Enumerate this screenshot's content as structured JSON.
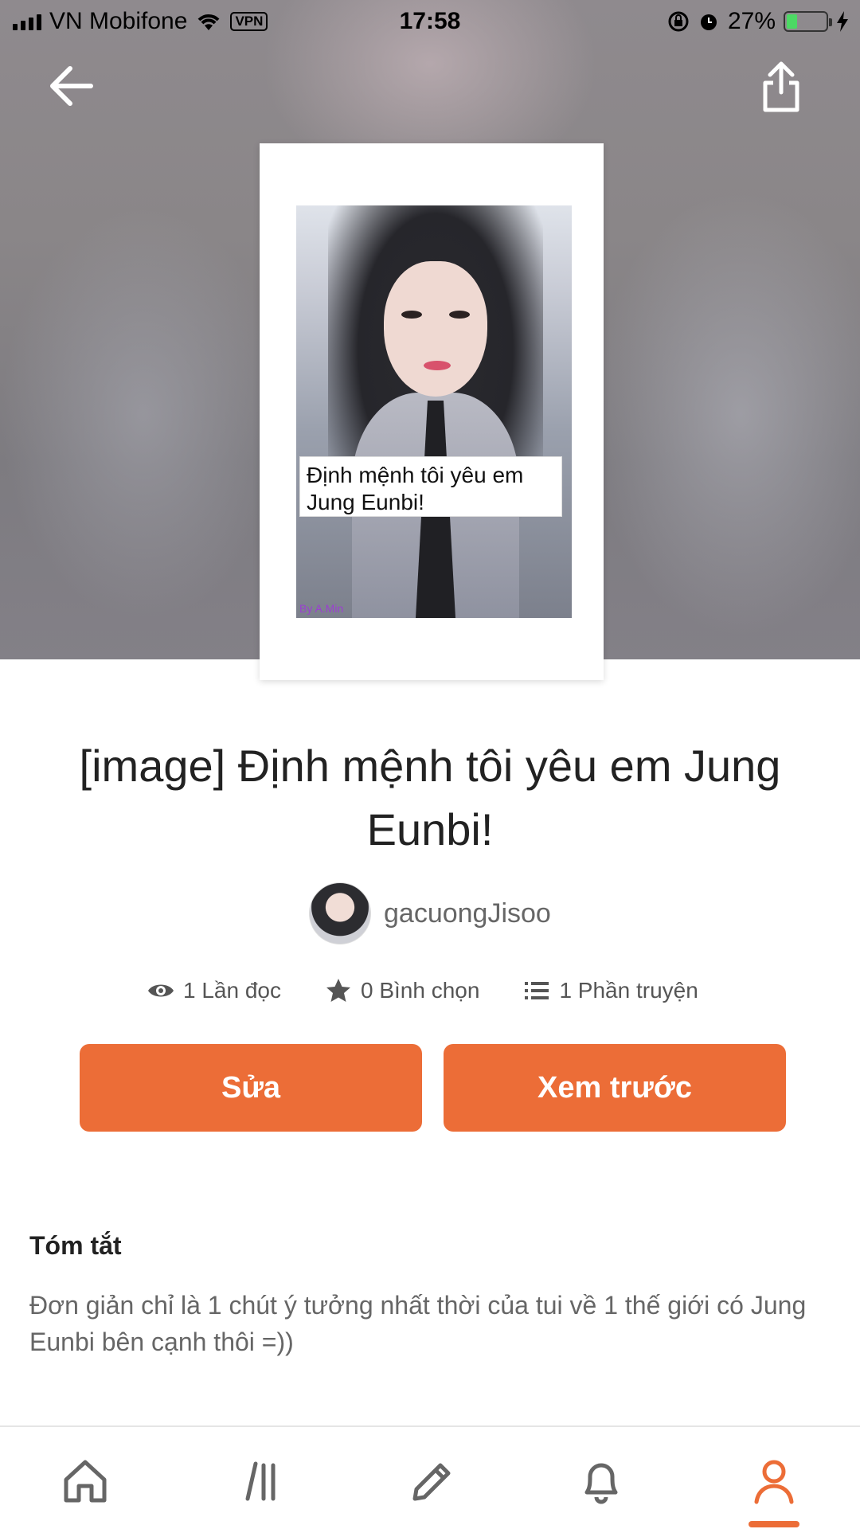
{
  "status_bar": {
    "carrier": "VN Mobifone",
    "vpn": "VPN",
    "time": "17:58",
    "battery": "27%",
    "battery_level": 0.27
  },
  "header": {
    "back_icon": "arrow-left-icon",
    "share_icon": "share-icon"
  },
  "cover": {
    "caption_line1": "Định mệnh tôi yêu em",
    "caption_line2": "Jung Eunbi!",
    "signature": "By A.Min"
  },
  "story": {
    "title": "[image] Định mệnh tôi yêu em Jung Eunbi!",
    "author": "gacuongJisoo"
  },
  "stats": {
    "reads": "1 Lần đọc",
    "votes": "0 Bình chọn",
    "parts": "1 Phần truyện"
  },
  "actions": {
    "edit_label": "Sửa",
    "preview_label": "Xem trước"
  },
  "summary": {
    "heading": "Tóm tắt",
    "text": "Đơn giản chỉ là 1 chút ý tưởng nhất thời của tui về 1 thế giới có Jung Eunbi bên cạnh thôi =))"
  },
  "tabbar": {
    "items": [
      "home-icon",
      "library-icon",
      "write-icon",
      "notifications-icon",
      "profile-icon"
    ],
    "active": "profile-icon",
    "accent": "#ec6d37"
  }
}
